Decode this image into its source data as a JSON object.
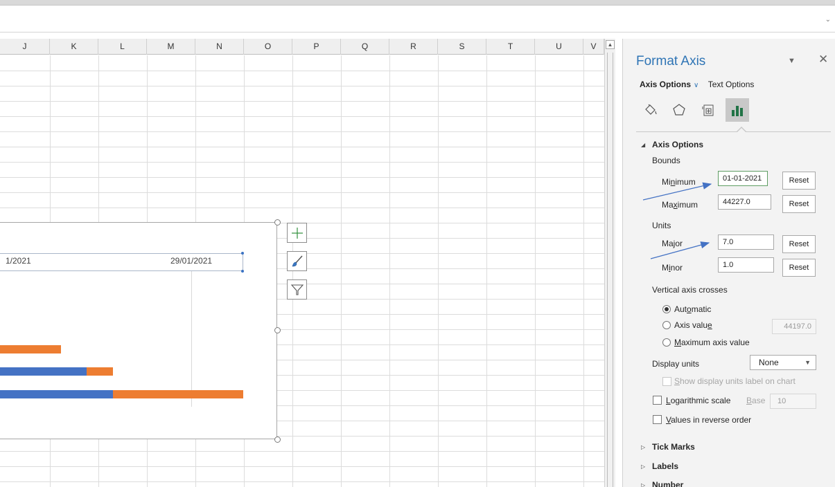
{
  "sheet": {
    "columns": [
      "J",
      "K",
      "L",
      "M",
      "N",
      "O",
      "P",
      "Q",
      "R",
      "S",
      "T",
      "U",
      "V"
    ]
  },
  "chart": {
    "tick_labels": [
      "1/2021",
      "29/01/2021"
    ]
  },
  "pane": {
    "title": "Format Axis",
    "tab_axis_options": "Axis Options",
    "tab_text_options": "Text Options",
    "section_title": "Axis Options",
    "bounds_label": "Bounds",
    "minimum": {
      "pre": "Mi",
      "key": "n",
      "post": "imum",
      "value": "01-01-2021"
    },
    "maximum": {
      "pre": "Ma",
      "key": "x",
      "post": "imum",
      "value": "44227.0"
    },
    "reset_label": "Reset",
    "units_label": "Units",
    "major": {
      "label": "Major",
      "value": "7.0"
    },
    "minor": {
      "pre": "M",
      "key": "i",
      "post": "nor",
      "value": "1.0"
    },
    "crosses_label": "Vertical axis crosses",
    "automatic": {
      "pre": "Aut",
      "key": "o",
      "post": "matic"
    },
    "axis_value": {
      "pre": "Axis valu",
      "key": "e",
      "post": "",
      "value": "44197.0"
    },
    "max_axis_value": {
      "pre": "",
      "key": "M",
      "post": "aximum axis value"
    },
    "display_units_label": "Display units",
    "display_units_value": "None",
    "show_units": {
      "pre": "",
      "key": "S",
      "post": "how display units label on chart"
    },
    "log_scale": {
      "pre": "",
      "key": "L",
      "post": "ogarithmic scale"
    },
    "base": {
      "pre": "",
      "key": "B",
      "post": "ase",
      "value": "10"
    },
    "reverse": {
      "pre": "",
      "key": "V",
      "post": "alues in reverse order"
    },
    "tick_marks": "Tick Marks",
    "labels": "Labels",
    "number": "Number"
  },
  "colors": {
    "accent": "#2e74b5",
    "series_blue": "#4472c4",
    "series_orange": "#ed7d31",
    "annotation_arrow": "#4472c4"
  }
}
